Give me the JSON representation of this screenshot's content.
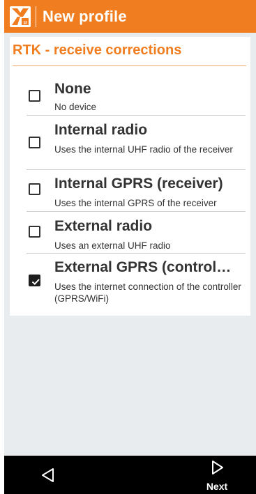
{
  "header": {
    "title": "New profile",
    "logo_icon": "leica-x-logo-icon",
    "accent_color": "#f07d1f"
  },
  "section": {
    "title": "RTK - receive corrections"
  },
  "options": [
    {
      "title": "None",
      "description": "No device",
      "checked": false
    },
    {
      "title": "Internal radio",
      "description": "Uses the internal UHF radio of the receiver",
      "checked": false
    },
    {
      "title": "Internal GPRS (receiver)",
      "description": "Uses the internal GPRS of the receiver",
      "checked": false
    },
    {
      "title": "External radio",
      "description": "Uses an external UHF radio",
      "checked": false
    },
    {
      "title": "External GPRS (control…",
      "description": "Uses the internet connection of the controller (GPRS/WiFi)",
      "checked": true
    }
  ],
  "nav": {
    "back_icon": "triangle-left-icon",
    "next_icon": "triangle-right-icon",
    "next_label": "Next"
  }
}
